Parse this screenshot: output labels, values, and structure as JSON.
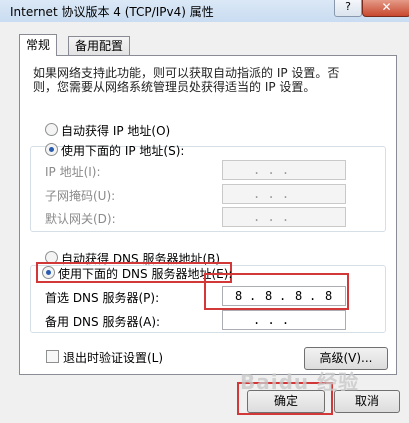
{
  "window": {
    "title": "Internet 协议版本 4 (TCP/IPv4) 属性",
    "help_label": "?",
    "close_label": "✕"
  },
  "tabs": [
    {
      "label": "常规",
      "active": true
    },
    {
      "label": "备用配置",
      "active": false
    }
  ],
  "description": "如果网络支持此功能，则可以获取自动指派的 IP 设置。否则，您需要从网络系统管理员处获得适当的 IP 设置。",
  "ip": {
    "auto_label": "自动获得 IP 地址(O)",
    "manual_label": "使用下面的 IP 地址(S):",
    "fields": [
      {
        "label": "IP 地址(I):",
        "value": ". . ."
      },
      {
        "label": "子网掩码(U):",
        "value": ". . ."
      },
      {
        "label": "默认网关(D):",
        "value": ". . ."
      }
    ]
  },
  "dns": {
    "auto_label": "自动获得 DNS 服务器地址(B)",
    "manual_label": "使用下面的 DNS 服务器地址(E):",
    "preferred_label": "首选 DNS 服务器(P):",
    "preferred_value": [
      "8",
      "8",
      "8",
      "8"
    ],
    "alternate_label": "备用 DNS 服务器(A):",
    "alternate_value": ". . ."
  },
  "validate_label": "退出时验证设置(L)",
  "advanced_label": "高级(V)...",
  "ok_label": "确定",
  "cancel_label": "取消",
  "watermark": "Baidu 经验",
  "accent_color": "#d33838"
}
